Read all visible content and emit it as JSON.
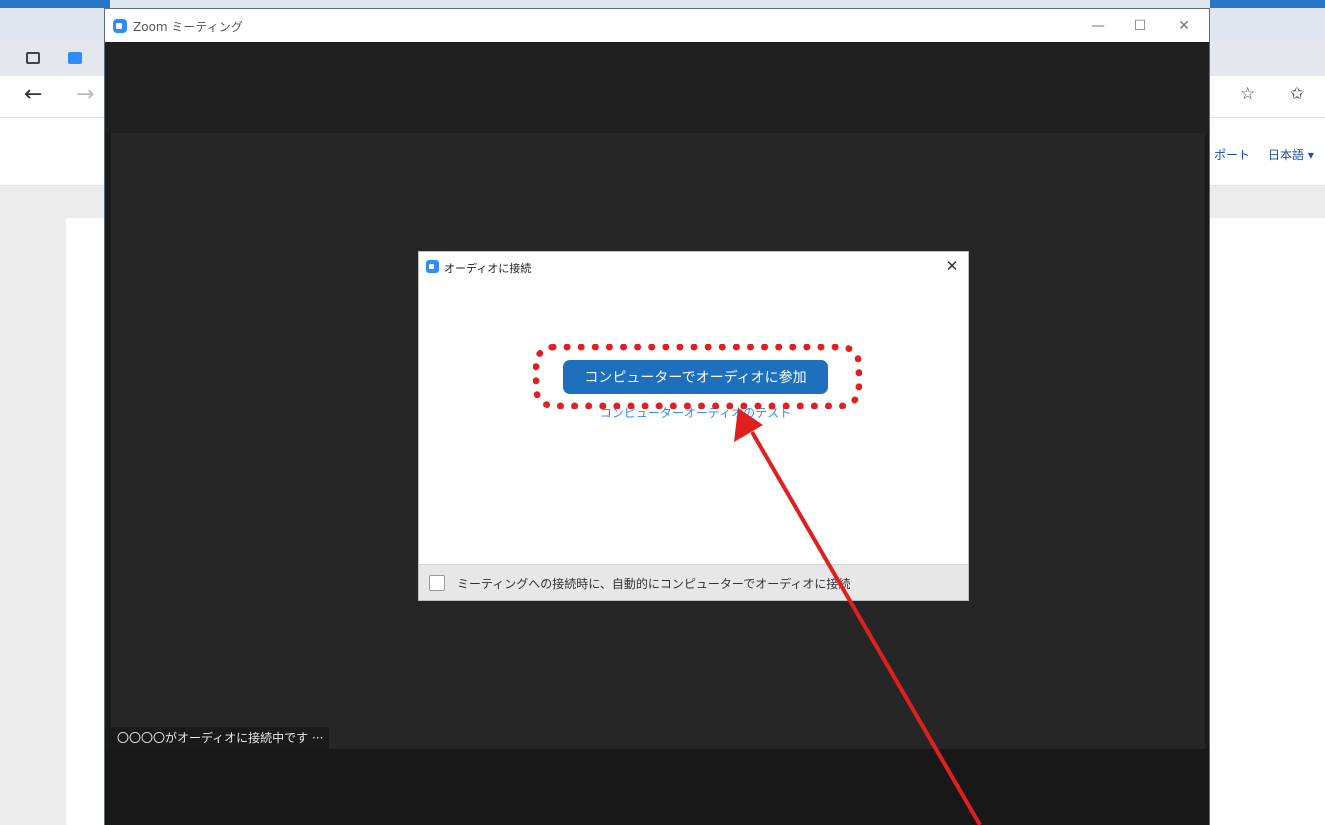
{
  "zoom_window": {
    "title": "Zoom ミーティング",
    "controls": {
      "minimize": "—",
      "maximize": "☐",
      "close": "✕"
    },
    "status_text": "〇〇〇〇がオーディオに接続中です ···"
  },
  "audio_dialog": {
    "title": "オーディオに接続",
    "close": "✕",
    "join_button": "コンピューターでオーディオに参加",
    "test_link": "コンピューターオーディオのテスト",
    "auto_join_label": "ミーティングへの接続時に、自動的にコンピューターでオーディオに接続"
  },
  "browser": {
    "nav_back": "←",
    "nav_forward": "→",
    "tab_icon": "tab-actions-icon",
    "favorites_icon": "☆",
    "collections_icon": "✩"
  },
  "website": {
    "nav_support": "ポート",
    "nav_language": "日本語 ▾"
  },
  "colors": {
    "zoom_blue": "#2d8cff",
    "button_blue": "#1f6fbf",
    "annotation_red": "#e02020"
  }
}
